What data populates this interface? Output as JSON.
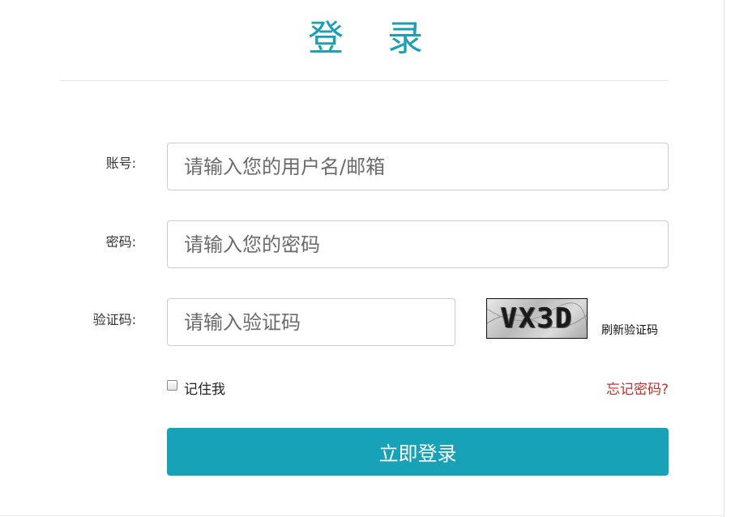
{
  "header": {
    "title": "登 录"
  },
  "form": {
    "account": {
      "label": "账号:",
      "placeholder": "请输入您的用户名/邮箱"
    },
    "password": {
      "label": "密码:",
      "placeholder": "请输入您的密码"
    },
    "captcha": {
      "label": "验证码:",
      "placeholder": "请输入验证码",
      "image_text": "VX3D",
      "refresh_label": "刷新验证码"
    },
    "remember": {
      "label": "记住我",
      "checked": false
    },
    "forgot_label": "忘记密码?",
    "submit_label": "立即登录"
  },
  "colors": {
    "accent": "#17a2b8",
    "title": "#1a9fb5",
    "forgot_link": "#c9302c"
  }
}
